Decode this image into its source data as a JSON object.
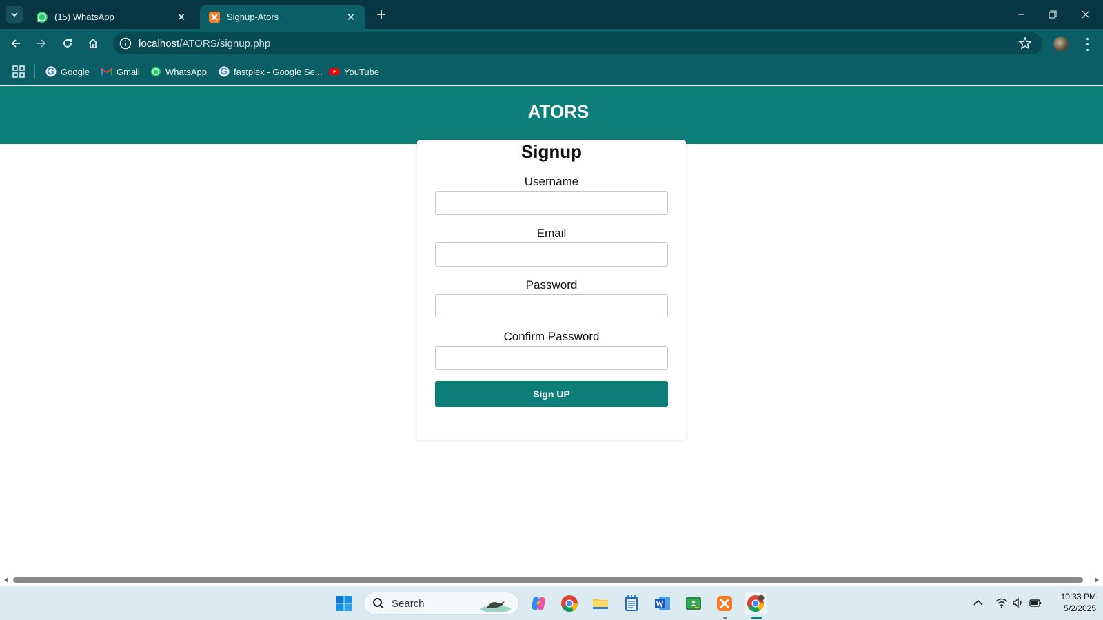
{
  "browser": {
    "tabs": [
      {
        "title": "(15) WhatsApp",
        "active": false,
        "icon": "whatsapp-icon"
      },
      {
        "title": "Signup-Ators",
        "active": true,
        "icon": "xampp-icon"
      }
    ],
    "url": {
      "host": "localhost",
      "path": "/ATORS/signup.php"
    },
    "bookmarks": [
      {
        "label": "Google",
        "icon": "google-icon"
      },
      {
        "label": "Gmail",
        "icon": "gmail-icon"
      },
      {
        "label": "WhatsApp",
        "icon": "whatsapp-icon"
      },
      {
        "label": "fastplex - Google Se...",
        "icon": "google-icon"
      },
      {
        "label": "YouTube",
        "icon": "youtube-icon"
      }
    ],
    "theme_color": "#0b5e66"
  },
  "page": {
    "site_title": "ATORS",
    "form": {
      "heading": "Signup",
      "fields": [
        {
          "label": "Username",
          "value": ""
        },
        {
          "label": "Email",
          "value": ""
        },
        {
          "label": "Password",
          "value": ""
        },
        {
          "label": "Confirm Password",
          "value": ""
        }
      ],
      "submit_label": "Sign UP"
    },
    "accent_color": "#0d7f7a"
  },
  "taskbar": {
    "search_placeholder": "Search",
    "clock_time": "10:33 PM",
    "clock_date": "5/2/2025",
    "pinned": [
      "windows-start-icon",
      "copilot-icon",
      "chrome-icon",
      "file-explorer-icon",
      "notepad-icon",
      "word-icon",
      "classroom-icon",
      "xampp-icon",
      "chrome-profile-icon"
    ]
  }
}
